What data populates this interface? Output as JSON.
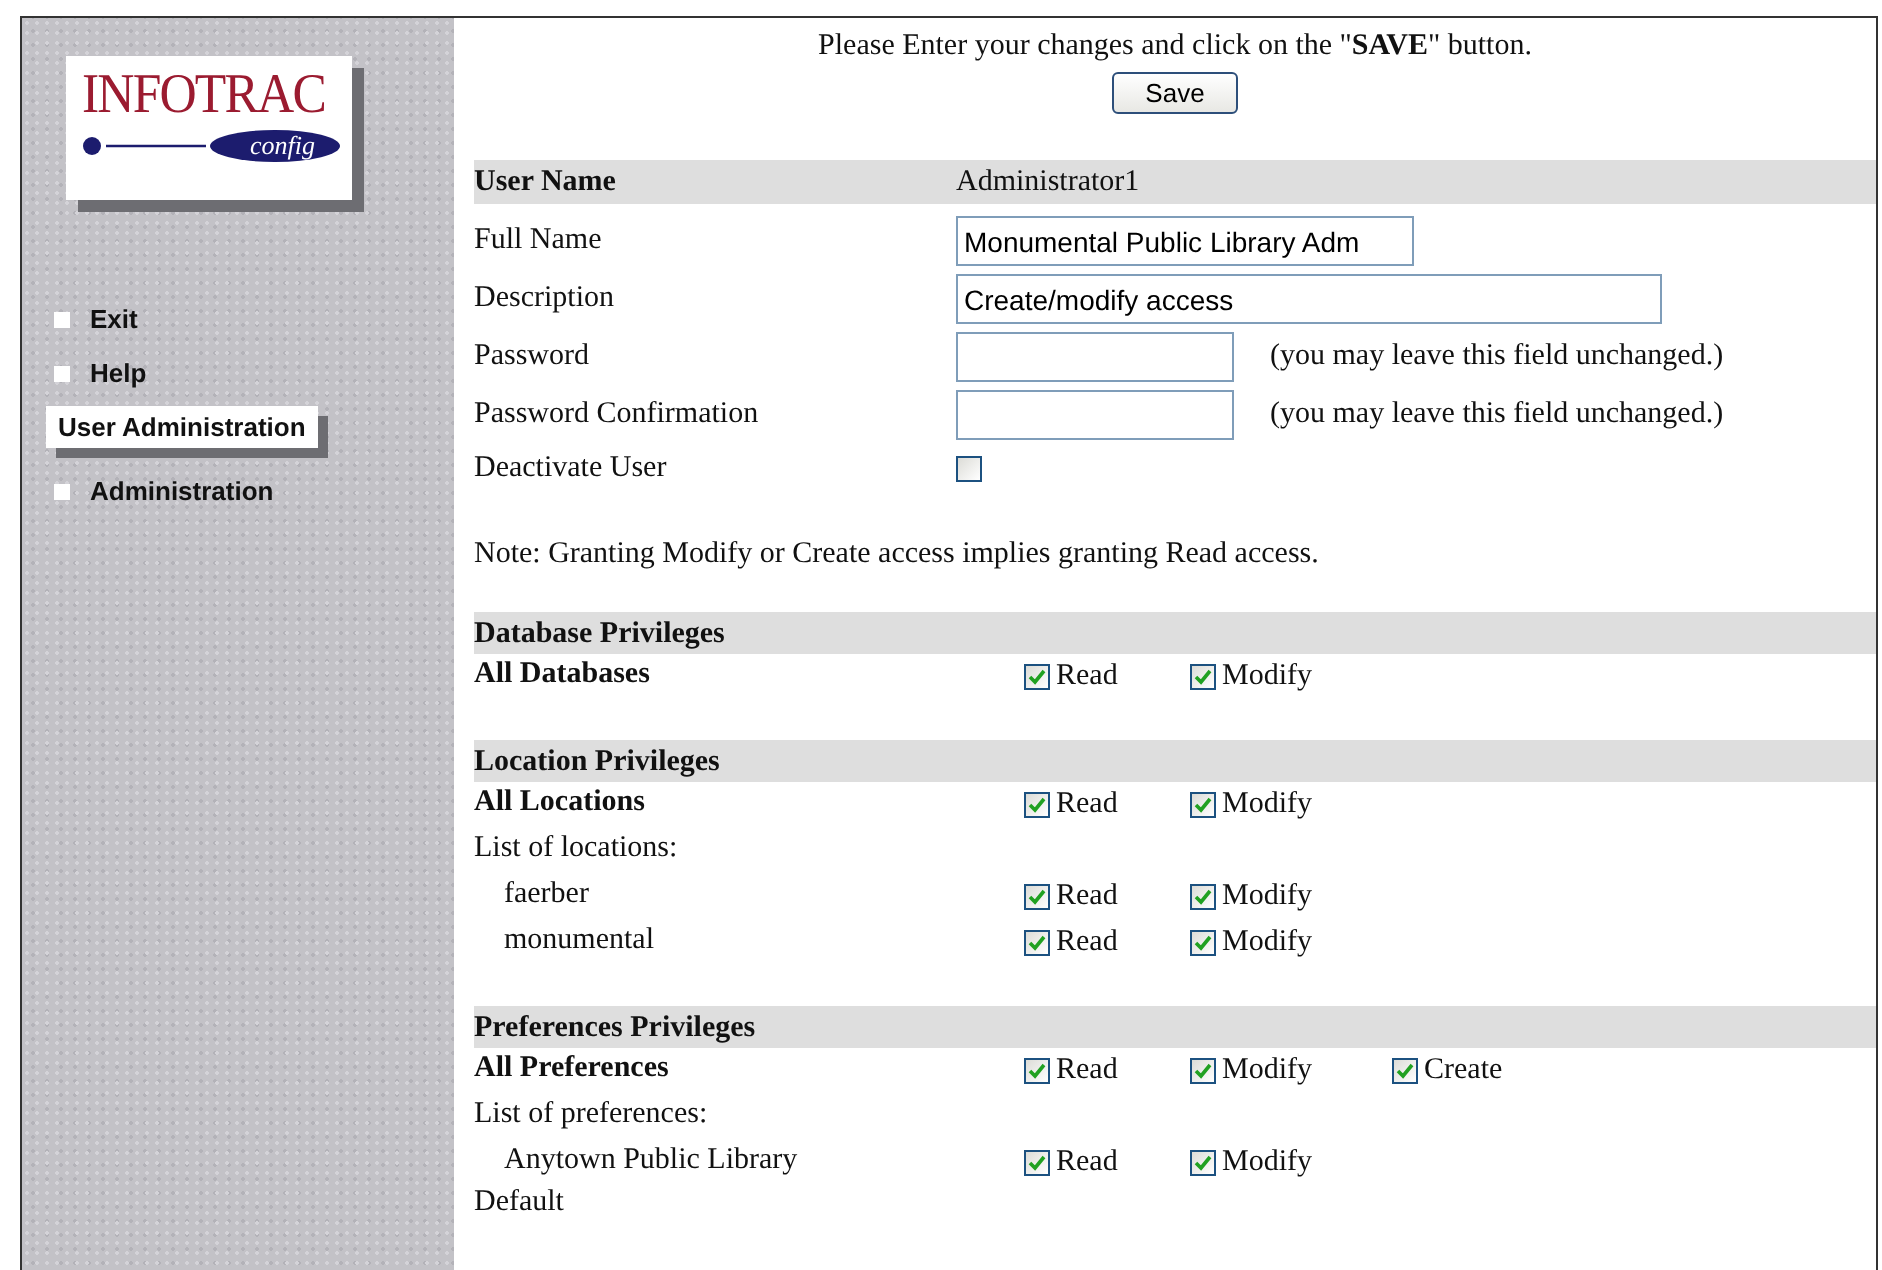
{
  "sidebar": {
    "logo": {
      "title": "INFOTRAC",
      "subtitle": "config"
    },
    "items": [
      {
        "label": "Exit",
        "selected": false
      },
      {
        "label": "Help",
        "selected": false
      },
      {
        "label": "User Administration",
        "selected": true
      },
      {
        "label": "Administration",
        "selected": false
      }
    ]
  },
  "instruction": "Please Enter your changes and click on the \"**SAVE**\" button.",
  "save_button": "Save",
  "user_fields": [
    {
      "kind": "readonly",
      "label": "User Name",
      "value": "Administrator1"
    },
    {
      "kind": "short_input",
      "label": "Full Name",
      "value": "Monumental Public Library Adm"
    },
    {
      "kind": "long_input",
      "label": "Description",
      "value": "Create/modify access"
    },
    {
      "kind": "password",
      "label": "Password",
      "hint": "(you may leave this field unchanged.)"
    },
    {
      "kind": "password",
      "label": "Password Confirmation",
      "hint": "(you may leave this field unchanged.)"
    },
    {
      "kind": "checkbox",
      "label": "Deactivate User",
      "checked": false
    }
  ],
  "note": "Note: Granting Modify or Create access implies granting Read access.",
  "sections": [
    {
      "title": "Database Privileges",
      "rows": [
        {
          "kind": "all",
          "label": "All Databases",
          "perms": [
            {
              "label": "Read",
              "checked": true
            },
            {
              "label": "Modify",
              "checked": true
            }
          ]
        }
      ]
    },
    {
      "title": "Location Privileges",
      "rows": [
        {
          "kind": "all",
          "label": "All Locations",
          "perms": [
            {
              "label": "Read",
              "checked": true
            },
            {
              "label": "Modify",
              "checked": true
            }
          ]
        },
        {
          "kind": "list_heading",
          "label": "List of locations:"
        },
        {
          "kind": "item",
          "label": "faerber",
          "perms": [
            {
              "label": "Read",
              "checked": true
            },
            {
              "label": "Modify",
              "checked": true
            }
          ]
        },
        {
          "kind": "item",
          "label": "monumental",
          "perms": [
            {
              "label": "Read",
              "checked": true
            },
            {
              "label": "Modify",
              "checked": true
            }
          ]
        }
      ]
    },
    {
      "title": "Preferences Privileges",
      "rows": [
        {
          "kind": "all",
          "label": "All Preferences",
          "perms": [
            {
              "label": "Read",
              "checked": true
            },
            {
              "label": "Modify",
              "checked": true
            },
            {
              "label": "Create",
              "checked": true
            }
          ]
        },
        {
          "kind": "list_heading",
          "label": "List of preferences:"
        },
        {
          "kind": "item",
          "label": "Anytown Public Library Default",
          "perms": [
            {
              "label": "Read",
              "checked": true
            },
            {
              "label": "Modify",
              "checked": true
            }
          ]
        }
      ]
    }
  ]
}
